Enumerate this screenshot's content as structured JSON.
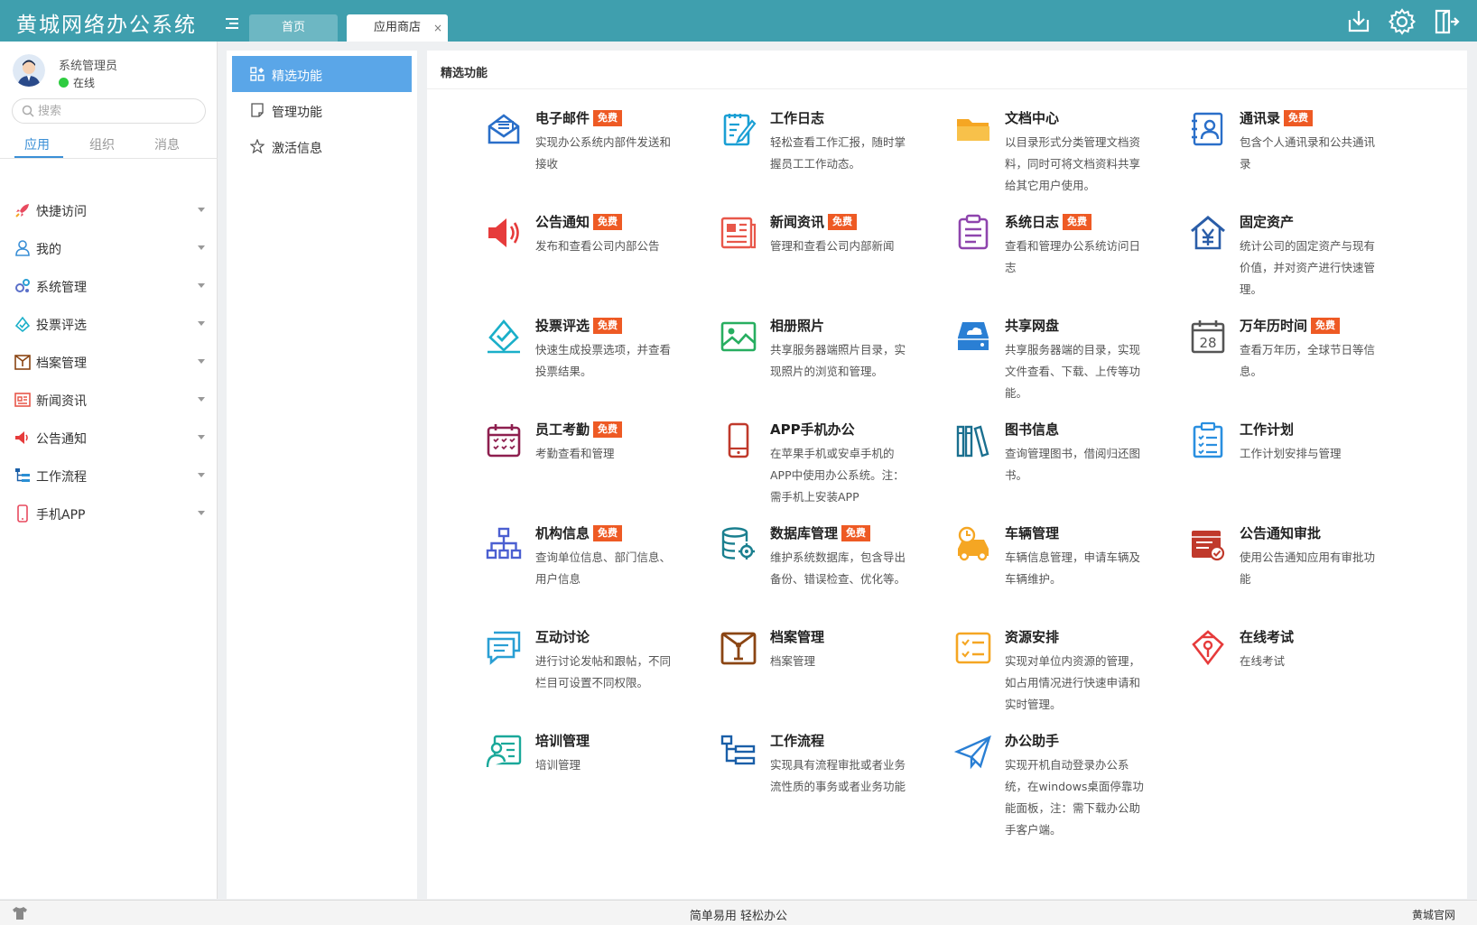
{
  "app": {
    "title": "黄城网络办公系统"
  },
  "tabs": [
    {
      "label": "首页"
    },
    {
      "label": "应用商店",
      "close": "×"
    }
  ],
  "user": {
    "name": "系统管理员",
    "status": "在线"
  },
  "search": {
    "placeholder": "搜索"
  },
  "side_tabs": [
    {
      "label": "应用"
    },
    {
      "label": "组织"
    },
    {
      "label": "消息"
    }
  ],
  "sidebar": {
    "items": [
      {
        "label": "快捷访问",
        "icon": "rocket-icon"
      },
      {
        "label": "我的",
        "icon": "user-icon"
      },
      {
        "label": "系统管理",
        "icon": "gears-icon"
      },
      {
        "label": "投票评选",
        "icon": "vote-icon"
      },
      {
        "label": "档案管理",
        "icon": "archive-icon"
      },
      {
        "label": "新闻资讯",
        "icon": "news-icon"
      },
      {
        "label": "公告通知",
        "icon": "speaker-icon"
      },
      {
        "label": "工作流程",
        "icon": "workflow-icon"
      },
      {
        "label": "手机APP",
        "icon": "phone-icon"
      }
    ]
  },
  "subnav": {
    "items": [
      {
        "label": "精选功能"
      },
      {
        "label": "管理功能"
      },
      {
        "label": "激活信息"
      }
    ]
  },
  "main": {
    "title": "精选功能",
    "cards": [
      {
        "title": "电子邮件",
        "badge": "免费",
        "desc": "实现办公系统内部件发送和接收",
        "icon": "email-icon",
        "color": "#2a6fc9"
      },
      {
        "title": "工作日志",
        "badge": "",
        "desc": "轻松查看工作汇报，随时掌握员工工作动态。",
        "icon": "worklog-icon",
        "color": "#1a9fd4"
      },
      {
        "title": "文档中心",
        "badge": "",
        "desc": "以目录形式分类管理文档资料，同时可将文档资料共享给其它用户使用。",
        "icon": "folder-icon",
        "color": "#f5a623"
      },
      {
        "title": "通讯录",
        "badge": "免费",
        "desc": "包含个人通讯录和公共通讯录",
        "icon": "contacts-icon",
        "color": "#2a6fc9"
      },
      {
        "title": "公告通知",
        "badge": "免费",
        "desc": "发布和查看公司内部公告",
        "icon": "announcement-icon",
        "color": "#e63b3b"
      },
      {
        "title": "新闻资讯",
        "badge": "免费",
        "desc": "管理和查看公司内部新闻",
        "icon": "newspaper-icon",
        "color": "#e8574a"
      },
      {
        "title": "系统日志",
        "badge": "免费",
        "desc": "查看和管理办公系统访问日志",
        "icon": "clipboard-icon",
        "color": "#8e44ad"
      },
      {
        "title": "固定资产",
        "badge": "",
        "desc": "统计公司的固定资产与现有价值，并对资产进行快速管理。",
        "icon": "asset-icon",
        "color": "#2a5da8"
      },
      {
        "title": "投票评选",
        "badge": "免费",
        "desc": "快速生成投票选项，并查看投票结果。",
        "icon": "ballot-icon",
        "color": "#1aafc9"
      },
      {
        "title": "相册照片",
        "badge": "",
        "desc": "共享服务器端照片目录，实现照片的浏览和管理。",
        "icon": "photo-icon",
        "color": "#27ae60"
      },
      {
        "title": "共享网盘",
        "badge": "",
        "desc": "共享服务器端的目录，实现文件查看、下载、上传等功能。",
        "icon": "cloud-disk-icon",
        "color": "#2a7fd4"
      },
      {
        "title": "万年历时间",
        "badge": "免费",
        "desc": "查看万年历，全球节日等信息。",
        "icon": "calendar-icon",
        "color": "#555555"
      },
      {
        "title": "员工考勤",
        "badge": "免费",
        "desc": "考勤查看和管理",
        "icon": "attendance-icon",
        "color": "#8e1f4f"
      },
      {
        "title": "APP手机办公",
        "badge": "",
        "desc": "在苹果手机或安卓手机的APP中使用办公系统。注：需手机上安装APP",
        "icon": "mobile-icon",
        "color": "#c0392b"
      },
      {
        "title": "图书信息",
        "badge": "",
        "desc": "查询管理图书，借阅归还图书。",
        "icon": "books-icon",
        "color": "#1a6f8f"
      },
      {
        "title": "工作计划",
        "badge": "",
        "desc": "工作计划安排与管理",
        "icon": "plan-icon",
        "color": "#2a8fe0"
      },
      {
        "title": "机构信息",
        "badge": "免费",
        "desc": "查询单位信息、部门信息、用户信息",
        "icon": "org-icon",
        "color": "#4b5fd1"
      },
      {
        "title": "数据库管理",
        "badge": "免费",
        "desc": "维护系统数据库，包含导出备份、错误检查、优化等。",
        "icon": "database-icon",
        "color": "#1a7f8f"
      },
      {
        "title": "车辆管理",
        "badge": "",
        "desc": "车辆信息管理，申请车辆及车辆维护。",
        "icon": "car-icon",
        "color": "#f5a623"
      },
      {
        "title": "公告通知审批",
        "badge": "",
        "desc": "使用公告通知应用有审批功能",
        "icon": "approval-icon",
        "color": "#c0392b"
      },
      {
        "title": "互动讨论",
        "badge": "",
        "desc": "进行讨论发帖和跟帖，不同栏目可设置不同权限。",
        "icon": "discussion-icon",
        "color": "#2a9fd4"
      },
      {
        "title": "档案管理",
        "badge": "",
        "desc": "档案管理",
        "icon": "archive-box-icon",
        "color": "#8b4513"
      },
      {
        "title": "资源安排",
        "badge": "",
        "desc": "实现对单位内资源的管理，如占用情况进行快速申请和实时管理。",
        "icon": "resource-icon",
        "color": "#f5a623"
      },
      {
        "title": "在线考试",
        "badge": "",
        "desc": "在线考试",
        "icon": "exam-icon",
        "color": "#e63b3b"
      },
      {
        "title": "培训管理",
        "badge": "",
        "desc": "培训管理",
        "icon": "training-icon",
        "color": "#1aa89a"
      },
      {
        "title": "工作流程",
        "badge": "",
        "desc": "实现具有流程审批或者业务流性质的事务或者业务功能",
        "icon": "flow-icon",
        "color": "#1a5fa8"
      },
      {
        "title": "办公助手",
        "badge": "",
        "desc": "实现开机自动登录办公系统，在windows桌面停靠功能面板，注：需下载办公助手客户端。",
        "icon": "paper-plane-icon",
        "color": "#2a7fd4"
      }
    ]
  },
  "footer": {
    "slogan": "简单易用 轻松办公",
    "link": "黄城官网"
  }
}
